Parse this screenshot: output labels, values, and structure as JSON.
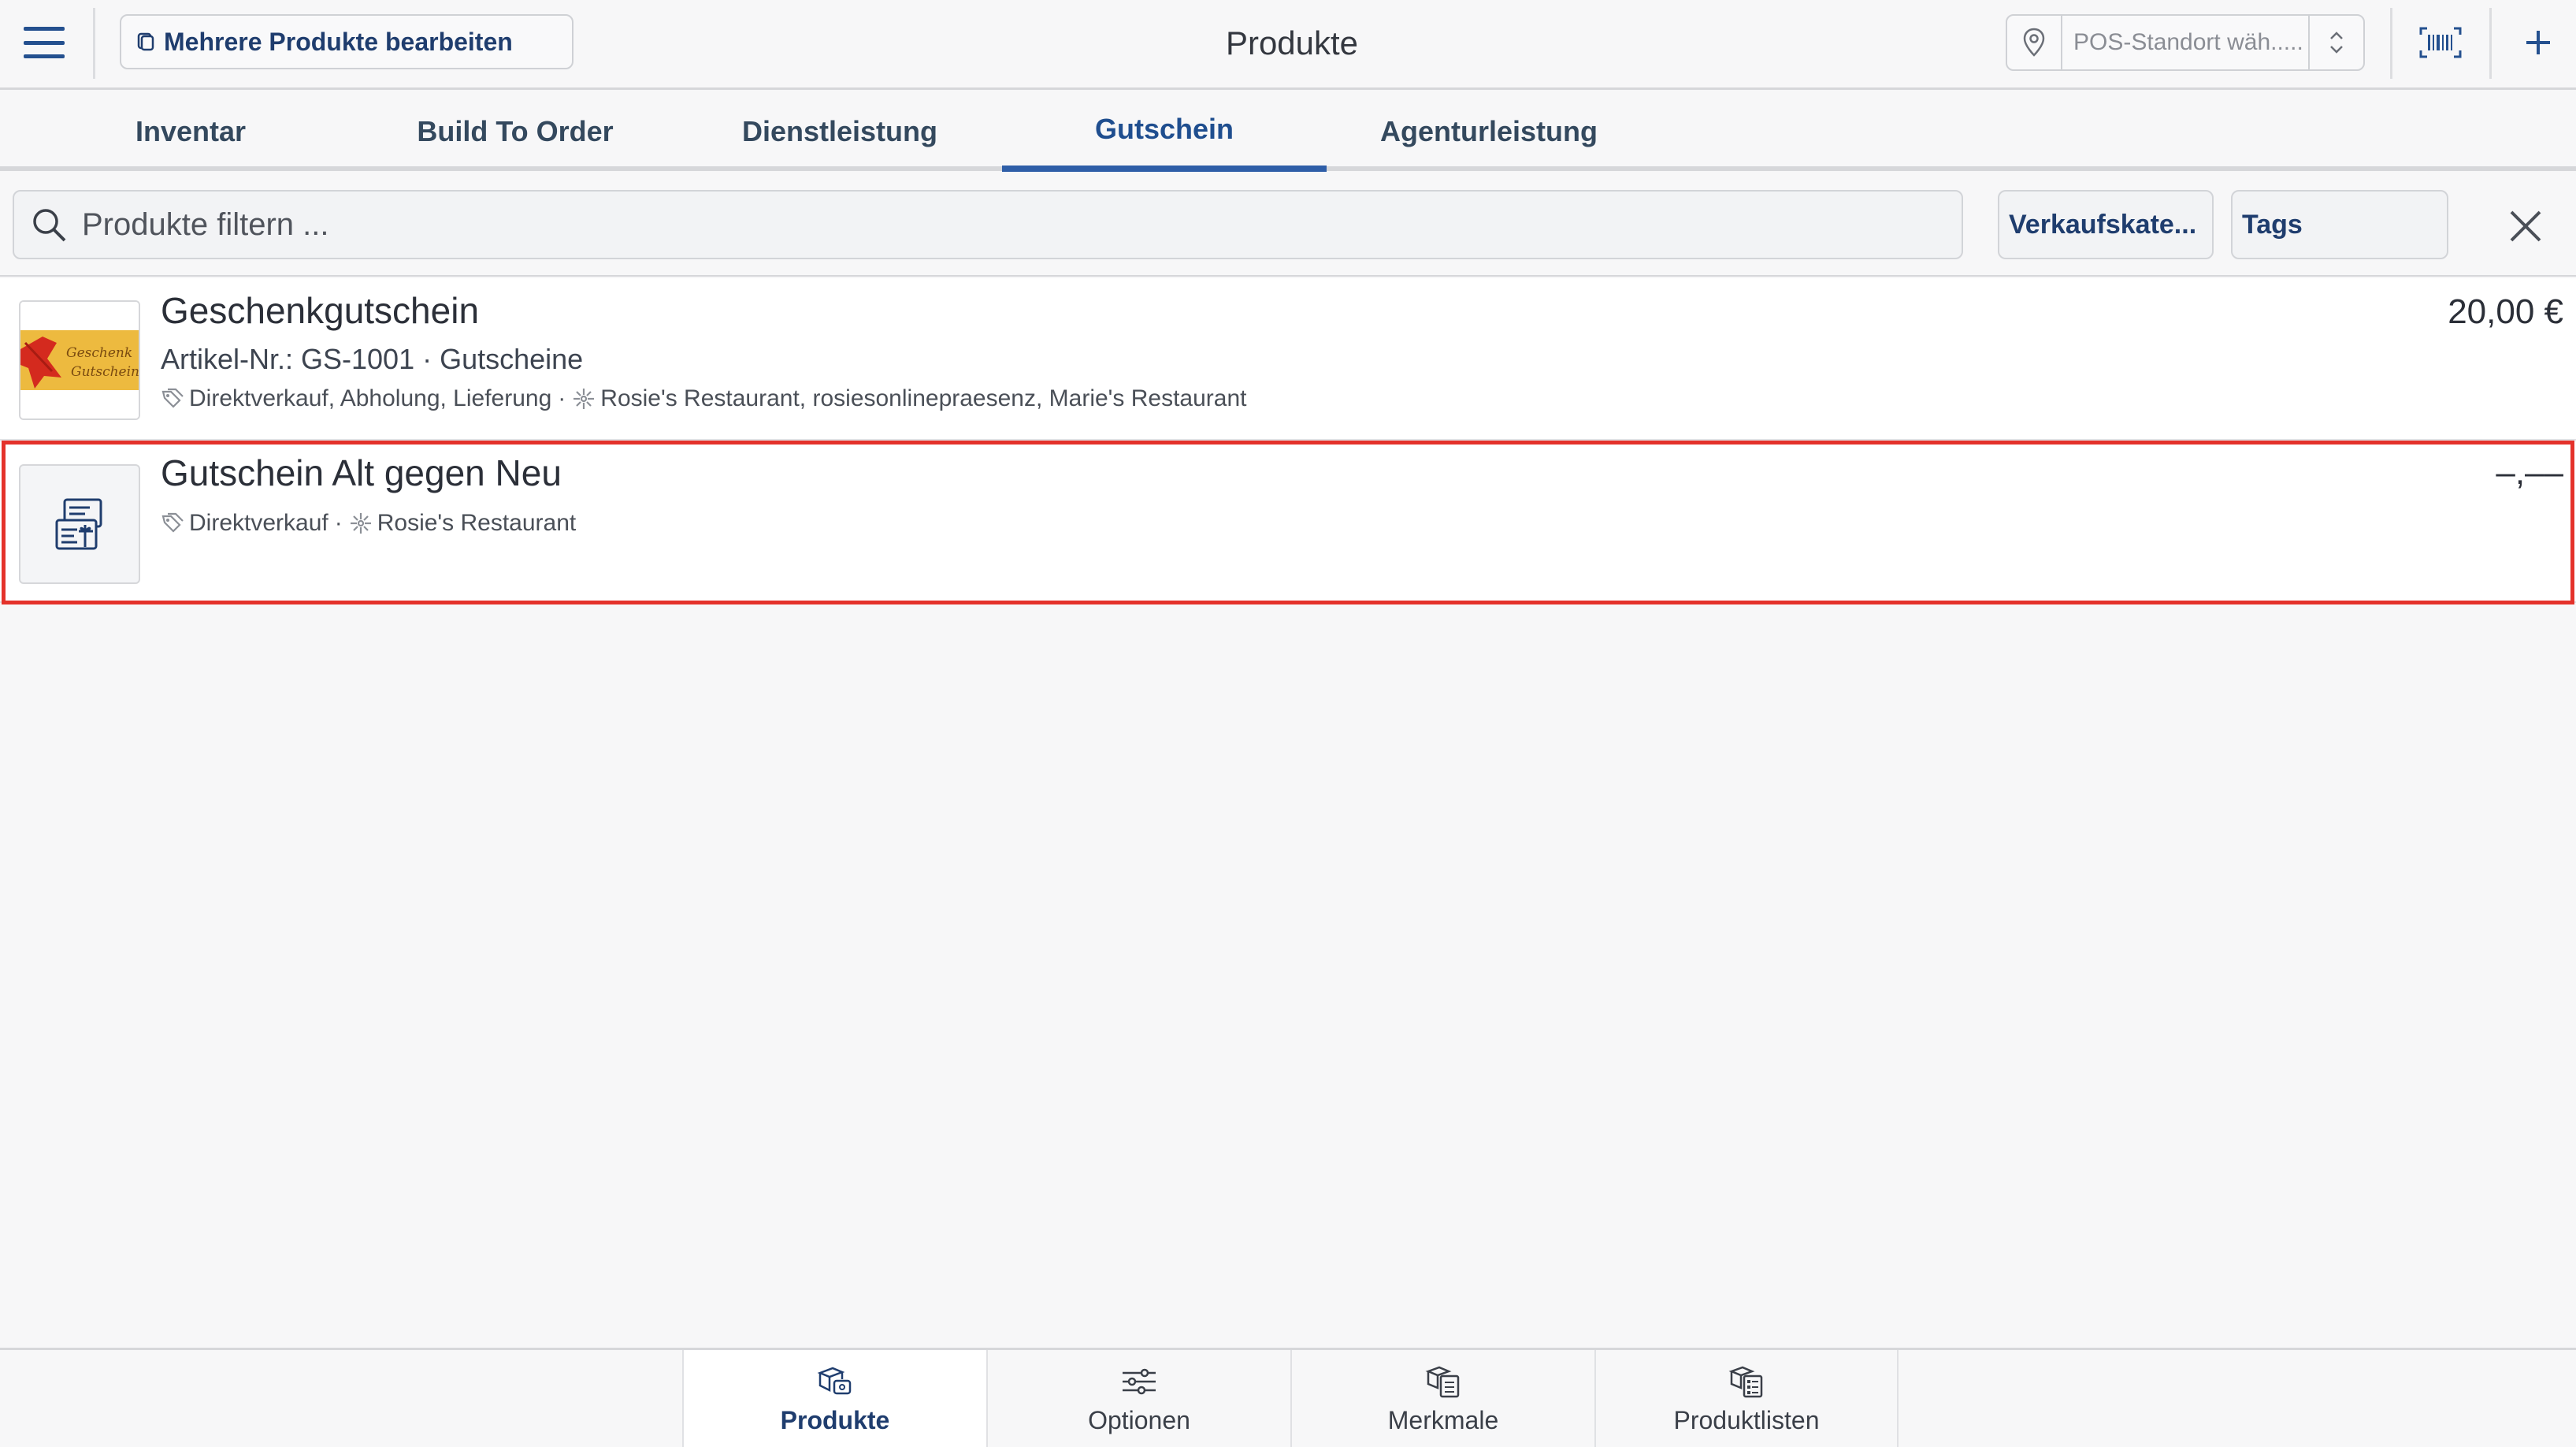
{
  "header": {
    "bulk_edit_label": "Mehrere Produkte bearbeiten",
    "title": "Produkte",
    "pos_placeholder": "POS-Standort wäh....."
  },
  "tabs": [
    {
      "label": "Inventar",
      "active": false
    },
    {
      "label": "Build To Order",
      "active": false
    },
    {
      "label": "Dienstleistung",
      "active": false
    },
    {
      "label": "Gutschein",
      "active": true
    },
    {
      "label": "Agenturleistung",
      "active": false
    }
  ],
  "filter": {
    "search_placeholder": "Produkte filtern ...",
    "category_label": "Verkaufskate...",
    "tags_label": "Tags"
  },
  "products": [
    {
      "name": "Geschenkgutschein",
      "subtitle": "Artikel-Nr.: GS-1001 · Gutscheine",
      "channels": "Direktverkauf, Abholung, Lieferung",
      "separator": "·",
      "locations": "Rosie's Restaurant, rosiesonlinepraesenz, Marie's Restaurant",
      "price": "20,00 €",
      "thumb_text_line1": "Geschenk",
      "thumb_text_line2": "Gutschein"
    },
    {
      "name": "Gutschein Alt gegen Neu",
      "channels": "Direktverkauf",
      "separator": "·",
      "locations": "Rosie's Restaurant",
      "price": "–,––"
    }
  ],
  "bottom_nav": [
    {
      "label": "Produkte",
      "icon": "products-icon",
      "active": true
    },
    {
      "label": "Optionen",
      "icon": "sliders-icon",
      "active": false
    },
    {
      "label": "Merkmale",
      "icon": "features-icon",
      "active": false
    },
    {
      "label": "Produktlisten",
      "icon": "product-lists-icon",
      "active": false
    }
  ],
  "colors": {
    "accent": "#2e5ea8",
    "highlight": "#e4322b"
  }
}
